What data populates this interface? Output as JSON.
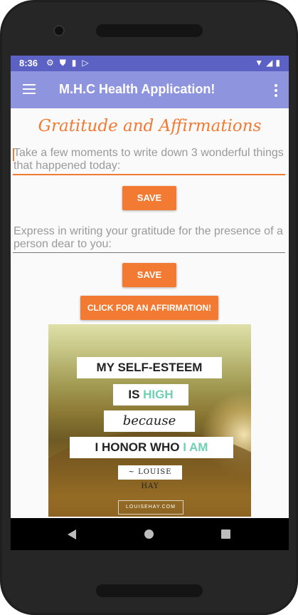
{
  "status_bar": {
    "time": "8:36"
  },
  "app_bar": {
    "title": "M.H.C Health Application!"
  },
  "page": {
    "heading": "Gratitude and Affirmations",
    "field1_placeholder": "Take a few moments to write down 3 wonderful things that happened today:",
    "save1_label": "SAVE",
    "field2_placeholder": "Express in writing your gratitude for the presence of a person dear to you:",
    "save2_label": "SAVE",
    "affirmation_button_label": "CLICK FOR AN AFFIRMATION!"
  },
  "affirmation_image": {
    "line1": "MY SELF-ESTEEM",
    "line2_a": "IS ",
    "line2_b": "HIGH",
    "line3": "because",
    "line4_a": "I HONOR WHO ",
    "line4_b": "I AM",
    "attribution": "~ LOUISE HAY",
    "watermark": "LOUISEHAY.COM"
  },
  "colors": {
    "accent": "#f27a32",
    "app_bar": "#8e94de",
    "status_bar": "#5c62c4",
    "highlight": "#6fd0b2"
  },
  "icons": [
    "settings-icon",
    "shield-icon",
    "sd-card-icon",
    "play-store-icon",
    "wifi-icon",
    "signal-icon",
    "battery-icon",
    "menu-icon",
    "more-vert-icon",
    "back-icon",
    "home-icon",
    "recents-icon"
  ]
}
